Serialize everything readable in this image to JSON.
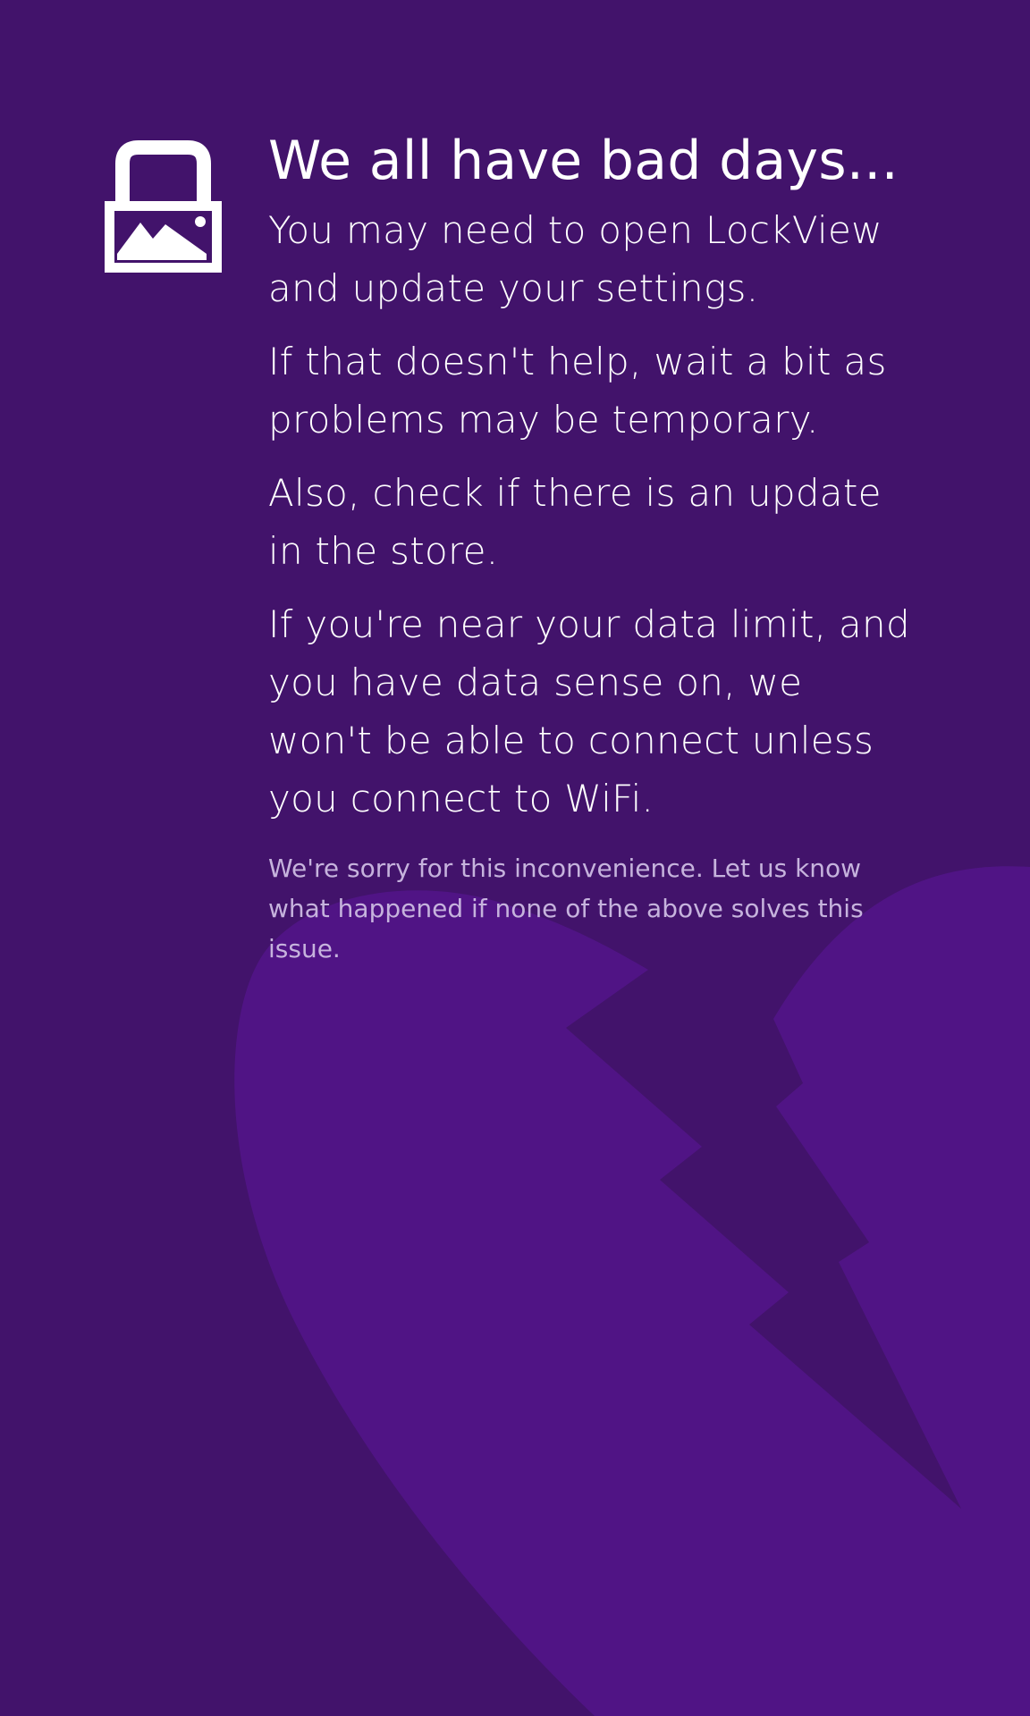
{
  "app": {
    "icon": "lock-with-picture-icon"
  },
  "message": {
    "title": "We all have bad days...",
    "paragraphs": [
      "You may need to open LockView and update your settings.",
      "If that doesn't help, wait a bit as problems may be temporary.",
      "Also, check if there is an update in the store.",
      "If you're near your data limit, and you have data sense on, we won't be able to connect unless you connect to WiFi."
    ],
    "note": "We're sorry for this inconvenience. Let us know what happened if none of the above solves this issue."
  },
  "background": {
    "art": "broken-heart-icon"
  },
  "colors": {
    "background": "#42136b",
    "heart": "#501485",
    "text": "#ffffff",
    "note_text": "#c6b3dd"
  }
}
